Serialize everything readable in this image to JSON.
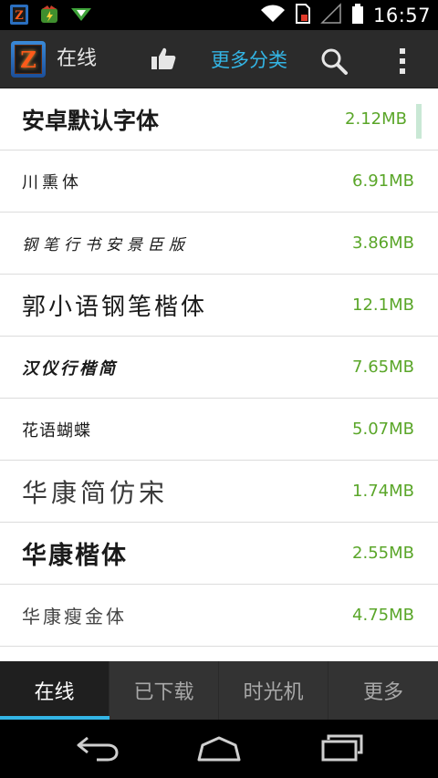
{
  "status_bar": {
    "time": "16:57",
    "left_icons": [
      "zfont-app-icon",
      "game-notification-icon",
      "download-notification-icon"
    ],
    "right_icons": [
      "wifi-icon",
      "sim-card-icon",
      "signal-icon",
      "battery-icon"
    ]
  },
  "action_bar": {
    "title": "在线",
    "more_categories": "更多分类",
    "accent_color": "#33b5e5",
    "icons": [
      "app-logo-icon",
      "thumbs-up-icon",
      "search-icon",
      "overflow-menu-icon"
    ]
  },
  "font_list": {
    "size_color": "#5aa629",
    "items": [
      {
        "name": "安卓默认字体",
        "size": "2.12MB"
      },
      {
        "name": "川熏体",
        "size": "6.91MB"
      },
      {
        "name": "钢笔行书安景臣版",
        "size": "3.86MB"
      },
      {
        "name": "郭小语钢笔楷体",
        "size": "12.1MB"
      },
      {
        "name": "汉仪行楷简",
        "size": "7.65MB"
      },
      {
        "name": "花语蝴蝶",
        "size": "5.07MB"
      },
      {
        "name": "华康简仿宋",
        "size": "1.74MB"
      },
      {
        "name": "华康楷体",
        "size": "2.55MB"
      },
      {
        "name": "华康瘦金体",
        "size": "4.75MB"
      }
    ]
  },
  "tabs": [
    {
      "label": "在线",
      "active": true
    },
    {
      "label": "已下载",
      "active": false
    },
    {
      "label": "时光机",
      "active": false
    },
    {
      "label": "更多",
      "active": false
    }
  ],
  "nav_bar": {
    "icons": [
      "back-icon",
      "home-icon",
      "recent-apps-icon"
    ]
  }
}
